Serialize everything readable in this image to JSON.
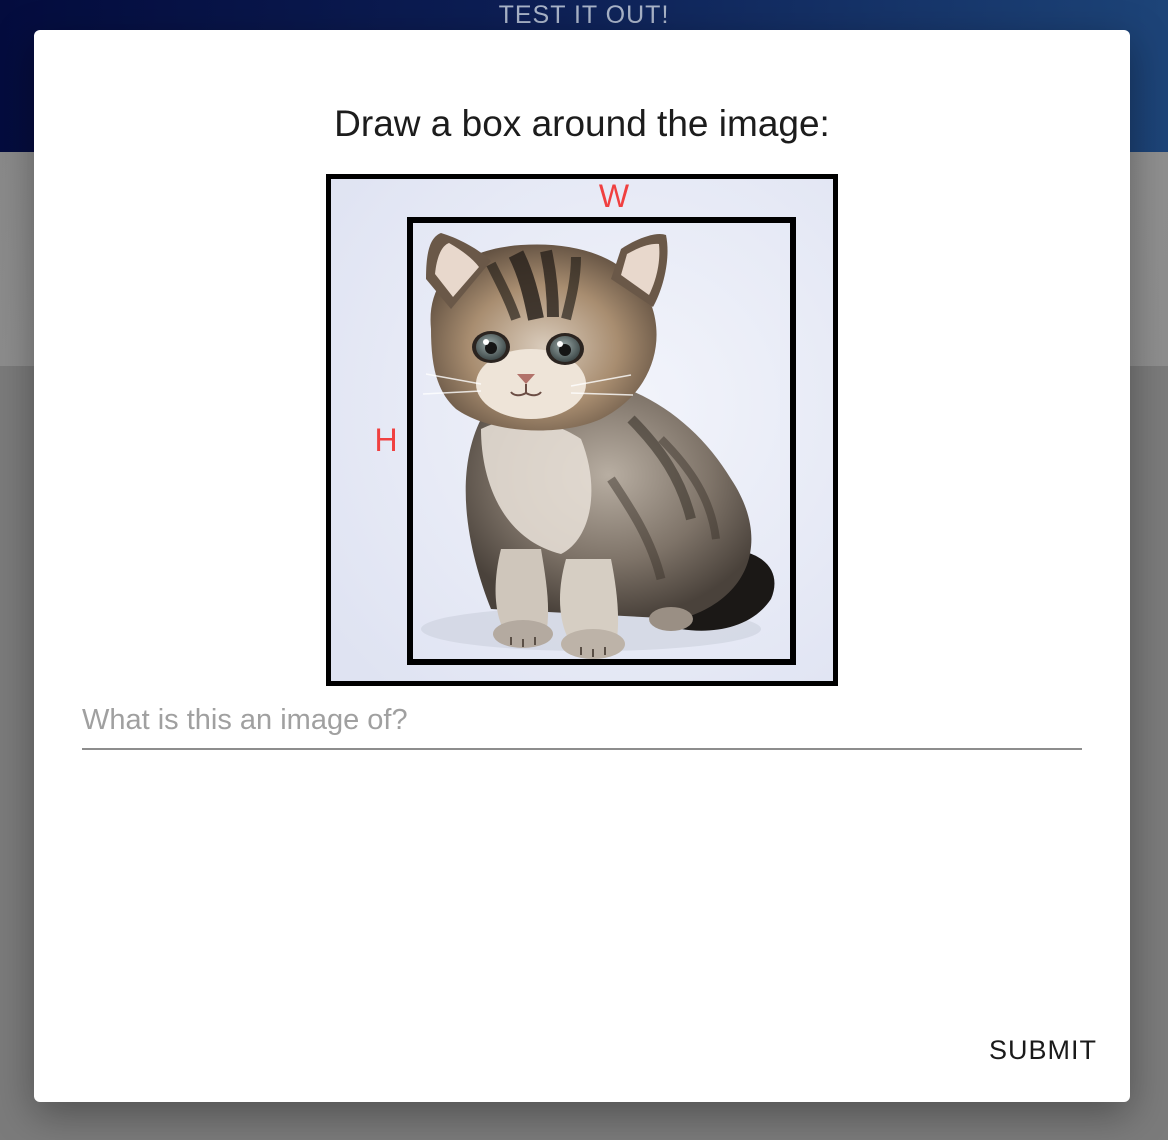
{
  "background": {
    "header_text": "TEST IT OUT!"
  },
  "dialog": {
    "title": "Draw a box around the image:",
    "image": {
      "subject": "kitten-photo",
      "box_labels": {
        "width": "W",
        "height": "H"
      },
      "label_color": "#f04040"
    },
    "input": {
      "placeholder": "What is this an image of?",
      "value": ""
    },
    "submit_label": "SUBMIT"
  },
  "colors": {
    "header_start": "#040c3e",
    "header_end": "#1d4478",
    "overlay": "#7a7a7a"
  }
}
